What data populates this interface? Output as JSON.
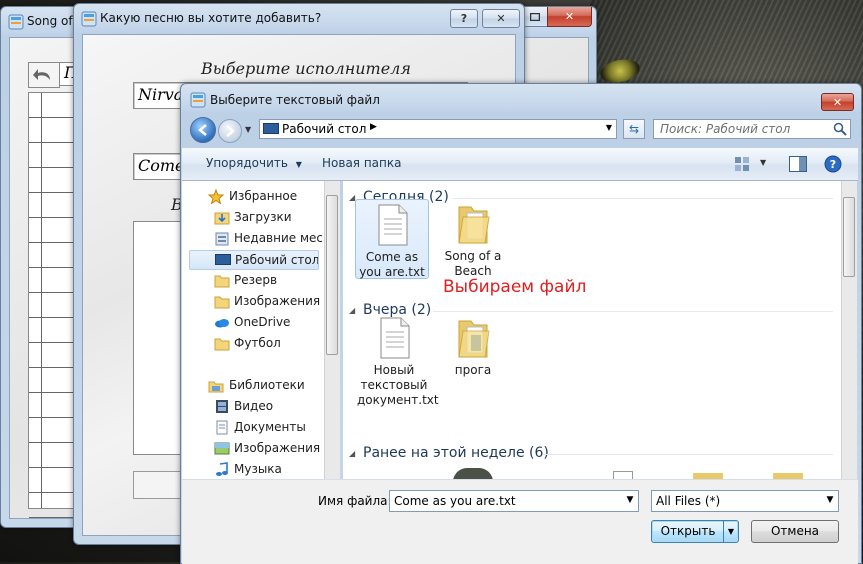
{
  "background_window": {
    "title": "Song of",
    "field_text": "П"
  },
  "question_window": {
    "title": "Какую песню вы хотите добавить?",
    "artist_prompt": "Выберите исполнителя",
    "artist_value": "Nirva",
    "song_value": "Come",
    "label_b": "В"
  },
  "dialog": {
    "title": "Выберите текстовый файл",
    "address": "Рабочий стол",
    "search_placeholder": "Поиск: Рабочий стол",
    "toolbar": {
      "organize": "Упорядочить",
      "new_folder": "Новая папка"
    },
    "nav": {
      "favorites_label": "Избранное",
      "favorites": [
        {
          "label": "Загрузки"
        },
        {
          "label": "Недавние мест"
        },
        {
          "label": "Рабочий стол"
        },
        {
          "label": "Резерв"
        },
        {
          "label": "Изображения"
        },
        {
          "label": "OneDrive"
        },
        {
          "label": "Футбол"
        }
      ],
      "libraries_label": "Библиотеки",
      "libraries": [
        {
          "label": "Видео"
        },
        {
          "label": "Документы"
        },
        {
          "label": "Изображения"
        },
        {
          "label": "Музыка"
        }
      ]
    },
    "groups": [
      {
        "label": "Сегодня (2)"
      },
      {
        "label": "Вчера (2)"
      },
      {
        "label": "Ранее на этой неделе (6)"
      }
    ],
    "files_today": [
      {
        "name": "Come as you are.txt"
      },
      {
        "name": "Song of a Beach"
      }
    ],
    "files_yesterday": [
      {
        "name": "Новый текстовый документ.txt"
      },
      {
        "name": "прога"
      }
    ],
    "annotation": "Выбираем файл",
    "filename_label": "Имя файла:",
    "filename_value": "Come as you are.txt",
    "filter_value": "All Files (*)",
    "open_button": "Открыть",
    "cancel_button": "Отмена",
    "help_glyph": "?",
    "close_glyph": "✕"
  },
  "colors": {
    "annotation": "#e02020",
    "group_heading": "#1e395b",
    "link": "#1e395b"
  }
}
